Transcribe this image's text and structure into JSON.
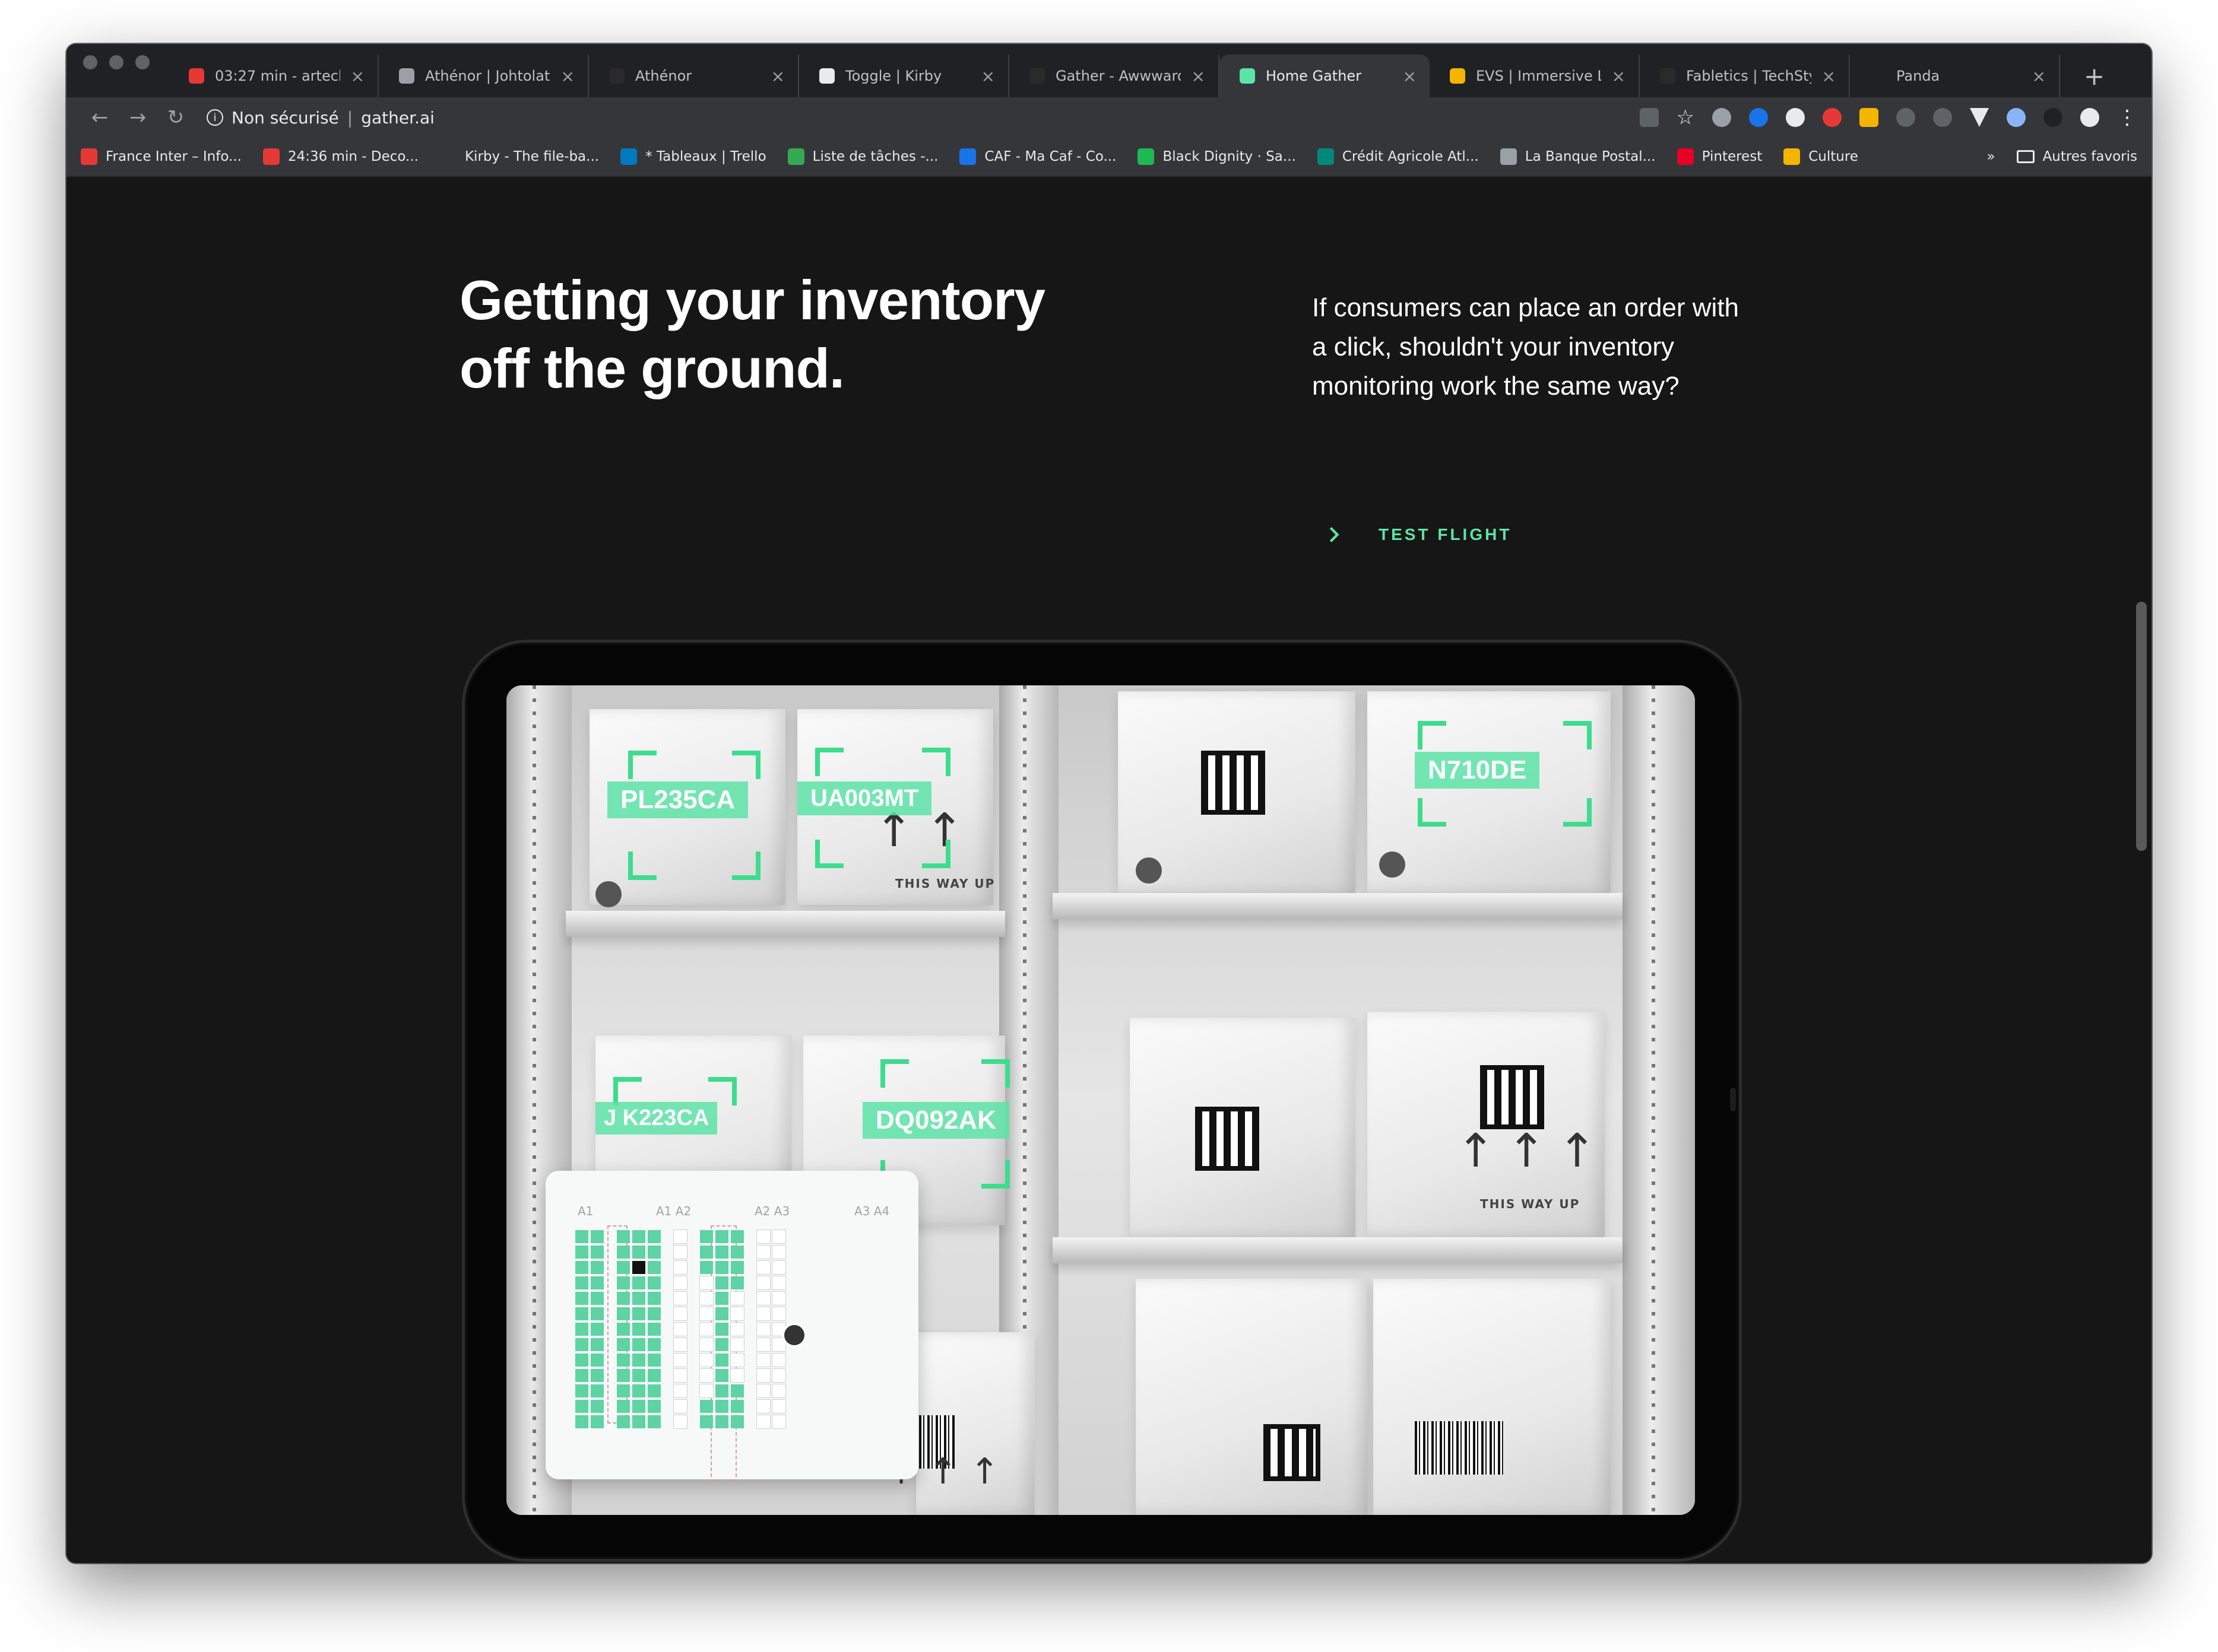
{
  "browser": {
    "tabs": [
      {
        "title": "03:27 min - arteck",
        "favicon_color": "#e53935",
        "active": false
      },
      {
        "title": "Athénor | Johtolat",
        "favicon_color": "#9aa0a6",
        "active": false
      },
      {
        "title": "Athénor",
        "favicon_color": "#2a2a2a",
        "active": false
      },
      {
        "title": "Toggle | Kirby",
        "favicon_color": "#e8eaed",
        "active": false
      },
      {
        "title": "Gather - Awwwards",
        "favicon_color": "#2a2a2a",
        "active": false
      },
      {
        "title": "Home Gather",
        "favicon_color": "#5de3a8",
        "active": true
      },
      {
        "title": "EVS | Immersive Liv",
        "favicon_color": "#f4b400",
        "active": false
      },
      {
        "title": "Fabletics | TechSty",
        "favicon_color": "#2a2a2a",
        "active": false
      },
      {
        "title": "Panda",
        "favicon_color": "#202124",
        "active": false
      }
    ],
    "address": {
      "security_label": "Non sécurisé",
      "url": "gather.ai"
    },
    "bookmarks": [
      {
        "label": "France Inter – Info...",
        "icon_color": "#e53935"
      },
      {
        "label": "24:36 min - Deco...",
        "icon_color": "#e53935"
      },
      {
        "label": "Kirby - The file-ba...",
        "icon_color": "#35363a"
      },
      {
        "label": "* Tableaux | Trello",
        "icon_color": "#0079bf"
      },
      {
        "label": "Liste de tâches -...",
        "icon_color": "#34a853"
      },
      {
        "label": "CAF - Ma Caf - Co...",
        "icon_color": "#1a73e8"
      },
      {
        "label": "Black Dignity · Sa...",
        "icon_color": "#1db954"
      },
      {
        "label": "Crédit Agricole Atl...",
        "icon_color": "#00897b"
      },
      {
        "label": "La Banque Postal...",
        "icon_color": "#9aa0a6"
      },
      {
        "label": "Pinterest",
        "icon_color": "#e60023"
      },
      {
        "label": "Culture",
        "icon_color": "#f4b400"
      }
    ],
    "bookmarks_overflow": "»",
    "other_bookmarks": "Autres favoris"
  },
  "hero": {
    "headline_line1": "Getting your inventory",
    "headline_line2": "off the ground.",
    "lede": "If consumers can place an order with a click, shouldn't your inventory monitoring work the same way?",
    "cta_label": "TEST FLIGHT",
    "accent_color": "#5de3a8"
  },
  "scene": {
    "scan_tags": [
      "PL235CA",
      "UA003MT",
      "N710DE",
      "J K223CA",
      "DQ092AK"
    ],
    "box_text": "THIS WAY UP",
    "inventory_columns": [
      "A1",
      "A1 A2",
      "A2 A3",
      "A3 A4"
    ]
  }
}
